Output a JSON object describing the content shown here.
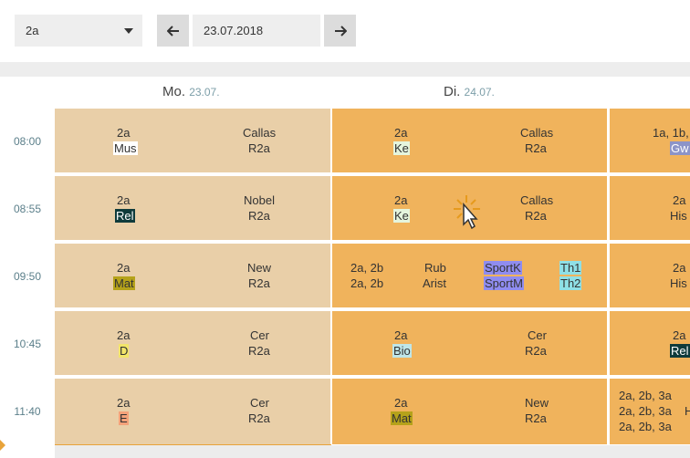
{
  "toolbar": {
    "class_value": "2a",
    "date_value": "23.07.2018"
  },
  "days": [
    {
      "name": "Mo.",
      "date": "23.07."
    },
    {
      "name": "Di.",
      "date": "24.07."
    }
  ],
  "times": [
    "08:00",
    "08:55",
    "09:50",
    "10:45",
    "11:40"
  ],
  "monday": [
    {
      "cls": "2a",
      "subject": "Mus",
      "teacher": "Callas",
      "room": "R2a",
      "color": "#ffffff"
    },
    {
      "cls": "2a",
      "subject": "Rel",
      "teacher": "Nobel",
      "room": "R2a",
      "color": "#0f3b3b"
    },
    {
      "cls": "2a",
      "subject": "Mat",
      "teacher": "New",
      "room": "R2a",
      "color": "#b5a21a"
    },
    {
      "cls": "2a",
      "subject": "D",
      "teacher": "Cer",
      "room": "R2a",
      "color": "#f2e56a"
    },
    {
      "cls": "2a",
      "subject": "E",
      "teacher": "Cer",
      "room": "R2a",
      "color": "#f4a27a"
    }
  ],
  "tuesday": [
    {
      "cls": "2a",
      "subject": "Ke",
      "teacher": "Callas",
      "room": "R2a",
      "color": "#e5f5dd"
    },
    {
      "cls": "2a",
      "subject": "Ke",
      "teacher": "Callas",
      "room": "R2a",
      "color": "#e5f5dd"
    },
    {
      "split": true,
      "cls1": "2a, 2b",
      "cls2": "2a, 2b",
      "t1": "Rub",
      "t2": "Arist",
      "s1": "SportK",
      "s2": "SportM",
      "r1": "Th1",
      "r2": "Th2",
      "scolor": "#8f8cf0",
      "rcolor": "#8fe0e6"
    },
    {
      "cls": "2a",
      "subject": "Bio",
      "teacher": "Cer",
      "room": "R2a",
      "color": "#bfe6e8"
    },
    {
      "cls": "2a",
      "subject": "Mat",
      "teacher": "New",
      "room": "R2a",
      "color": "#b5a21a"
    }
  ],
  "wednesday_partial": [
    {
      "line1": "1a, 1b,",
      "line2": "Gw",
      "color2": "#8c94c8"
    },
    {
      "line1": "2a",
      "line2": "His"
    },
    {
      "line1": "2a",
      "line2": "His"
    },
    {
      "line1": "2a",
      "line2": "Rel",
      "color2": "#0f3b3b"
    },
    {
      "line1": "2a, 2b, 3a",
      "line2": "2a, 2b, 3a",
      "line3": "2a, 2b, 3a",
      "extra": "H"
    }
  ],
  "colors": {
    "monday_bg": "#e9cfa8",
    "tuesday_bg": "#f0b35c",
    "now_marker": "#e8a33a"
  }
}
